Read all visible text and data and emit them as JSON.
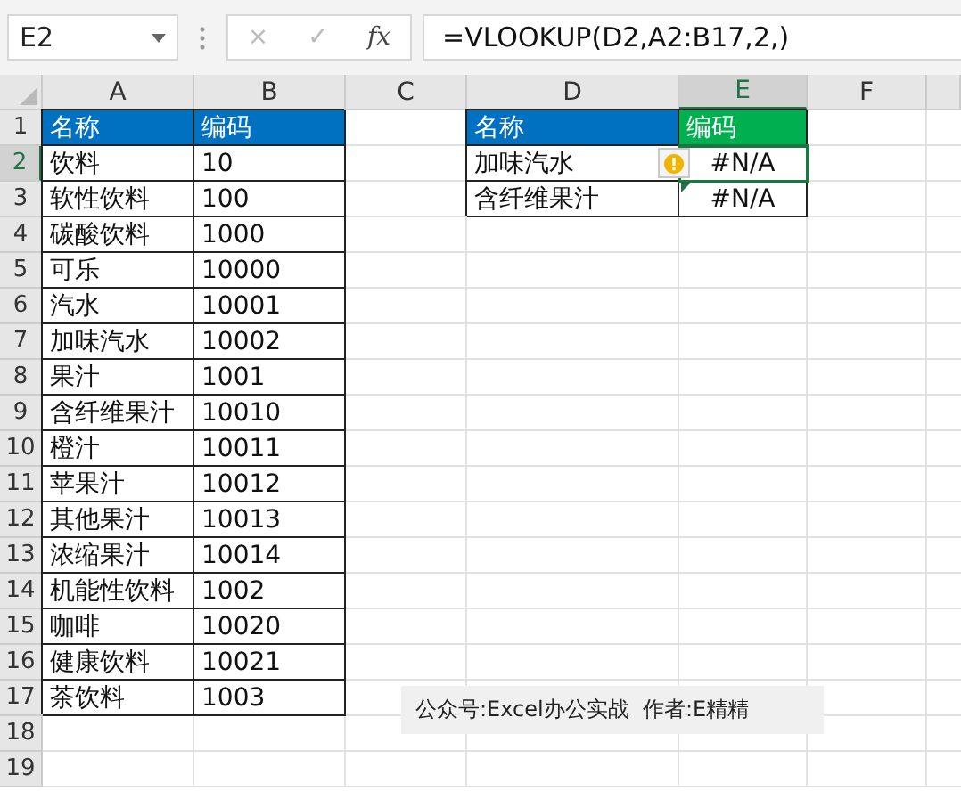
{
  "name_box": "E2",
  "formula_buttons": [
    "×",
    "✓",
    "fx"
  ],
  "formula": "=VLOOKUP(D2,A2:B17,2,)",
  "columns": [
    {
      "label": "A",
      "selected": false
    },
    {
      "label": "B",
      "selected": false
    },
    {
      "label": "C",
      "selected": false
    },
    {
      "label": "D",
      "selected": false
    },
    {
      "label": "E",
      "selected": true
    },
    {
      "label": "F",
      "selected": false
    }
  ],
  "rows": [
    {
      "number": "1",
      "selected": false,
      "a": {
        "text": "名称",
        "color": "#0070c0"
      },
      "b": {
        "text": "编码",
        "color": "#0070c0"
      },
      "d": {
        "text": "名称",
        "color": "#0070c0"
      },
      "e": {
        "text": "编码",
        "color": "#00b050"
      }
    },
    {
      "number": "2",
      "selected": true,
      "a": "饮料",
      "b": "10",
      "d": "加味汽水",
      "e": {
        "text": "#N/A",
        "error_flag": true,
        "selected": true,
        "smart_tag": true
      }
    },
    {
      "number": "3",
      "selected": false,
      "a": "软性饮料",
      "b": "100",
      "d": "含纤维果汁",
      "e": {
        "text": "#N/A",
        "error_flag": true,
        "selected": false,
        "smart_tag": false
      }
    },
    {
      "number": "4",
      "selected": false,
      "a": "碳酸饮料",
      "b": "1000"
    },
    {
      "number": "5",
      "selected": false,
      "a": "可乐",
      "b": "10000"
    },
    {
      "number": "6",
      "selected": false,
      "a": "汽水",
      "b": "10001"
    },
    {
      "number": "7",
      "selected": false,
      "a": "加味汽水",
      "b": "10002"
    },
    {
      "number": "8",
      "selected": false,
      "a": "果汁",
      "b": "1001"
    },
    {
      "number": "9",
      "selected": false,
      "a": "含纤维果汁",
      "b": "10010"
    },
    {
      "number": "10",
      "selected": false,
      "a": "橙汁",
      "b": "10011"
    },
    {
      "number": "11",
      "selected": false,
      "a": "苹果汁",
      "b": "10012"
    },
    {
      "number": "12",
      "selected": false,
      "a": "其他果汁",
      "b": "10013"
    },
    {
      "number": "13",
      "selected": false,
      "a": "浓缩果汁",
      "b": "10014"
    },
    {
      "number": "14",
      "selected": false,
      "a": "机能性饮料",
      "b": "1002"
    },
    {
      "number": "15",
      "selected": false,
      "a": "咖啡",
      "b": "10020"
    },
    {
      "number": "16",
      "selected": false,
      "a": "健康饮料",
      "b": "10021"
    },
    {
      "number": "17",
      "selected": false,
      "a": "茶饮料",
      "b": "1003"
    },
    {
      "number": "18",
      "selected": false
    },
    {
      "number": "19",
      "selected": false
    }
  ],
  "text_box": "公众号:Excel办公实战  作者:E精精"
}
